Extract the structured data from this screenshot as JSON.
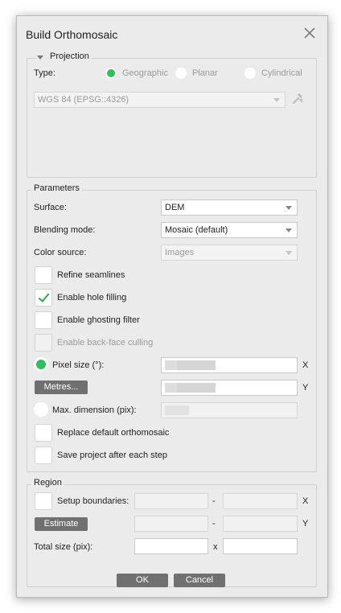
{
  "dialog": {
    "title": "Build Orthomosaic"
  },
  "projection": {
    "legend": "Projection",
    "type_label": "Type:",
    "options": [
      "Geographic",
      "Planar",
      "Cylindrical"
    ],
    "selected": "Geographic",
    "crs_value": "WGS 84 (EPSG::4326)"
  },
  "parameters": {
    "legend": "Parameters",
    "surface_label": "Surface:",
    "surface_value": "DEM",
    "blending_label": "Blending mode:",
    "blending_value": "Mosaic (default)",
    "color_label": "Color source:",
    "color_value": "Images",
    "refine_seamlines": "Refine seamlines",
    "enable_hole_filling": "Enable hole filling",
    "enable_ghosting_filter": "Enable ghosting filter",
    "enable_back_face_culling": "Enable back-face culling",
    "pixel_size_label": "Pixel size (°):",
    "metres_button": "Metres...",
    "max_dimension_label": "Max. dimension (pix):",
    "replace_default": "Replace default orthomosaic",
    "save_project": "Save project after each step",
    "x_label": "X",
    "y_label": "Y",
    "checks": {
      "refine_seamlines": false,
      "enable_hole_filling": true,
      "enable_ghosting_filter": false,
      "enable_back_face_culling": false,
      "replace_default": false,
      "save_project": false
    }
  },
  "region": {
    "legend": "Region",
    "setup_boundaries": "Setup boundaries:",
    "estimate_button": "Estimate",
    "total_size_label": "Total size (pix):",
    "dash": "-",
    "times": "x",
    "x_label": "X",
    "y_label": "Y"
  },
  "buttons": {
    "ok": "OK",
    "cancel": "Cancel"
  },
  "colors": {
    "accent": "#2ec05a",
    "check": "#2aa84e",
    "button": "#707070",
    "dialog_bg": "#ebebeb"
  }
}
